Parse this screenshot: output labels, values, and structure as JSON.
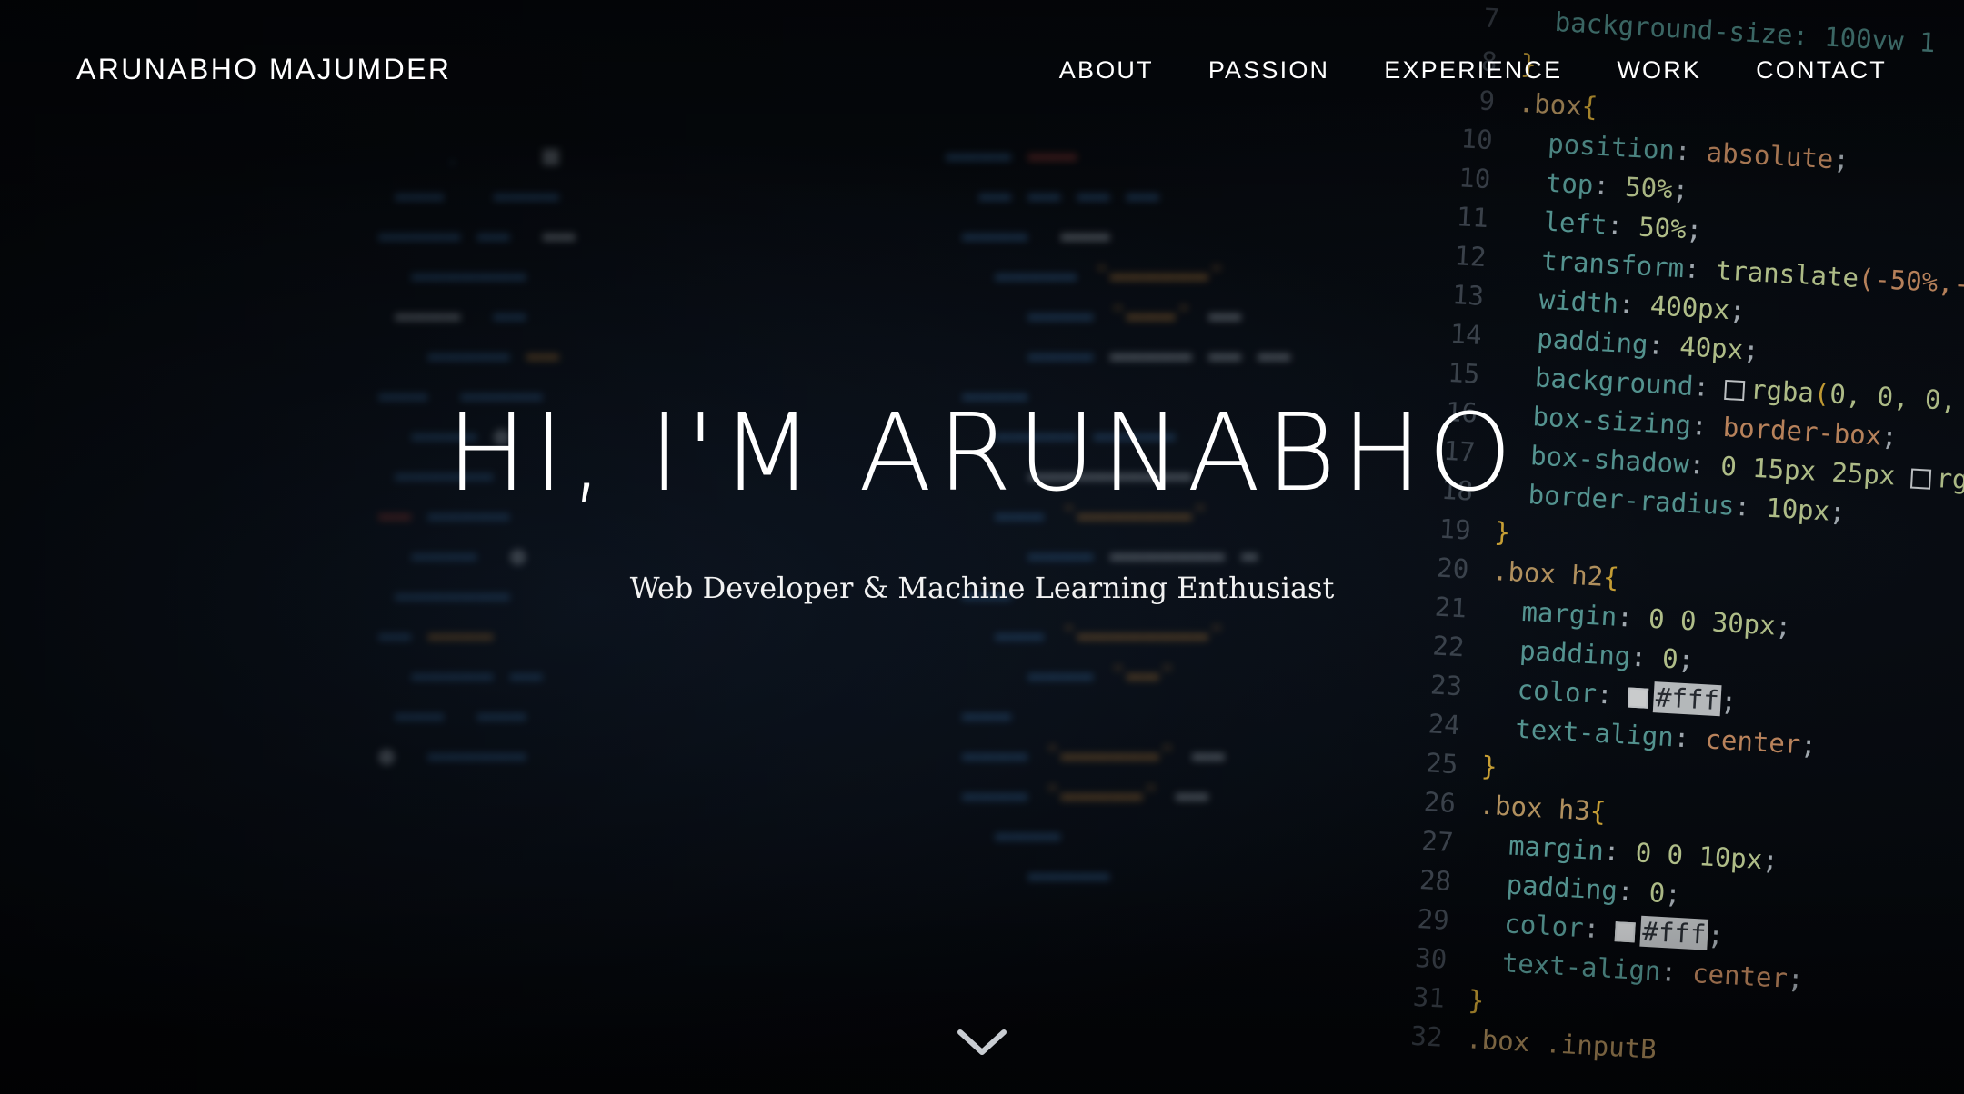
{
  "brand": {
    "name": "ARUNABHO MAJUMDER"
  },
  "nav": {
    "items": [
      {
        "label": "ABOUT"
      },
      {
        "label": "PASSION"
      },
      {
        "label": "EXPERIENCE"
      },
      {
        "label": "WORK"
      },
      {
        "label": "CONTACT"
      }
    ]
  },
  "hero": {
    "title": "HI, I'M ARUNABHO",
    "subtitle": "Web Developer & Machine Learning Enthusiast",
    "scroll_icon": "chevron-down-icon"
  },
  "colors": {
    "text": "#ffffff",
    "background": "#05080c"
  }
}
